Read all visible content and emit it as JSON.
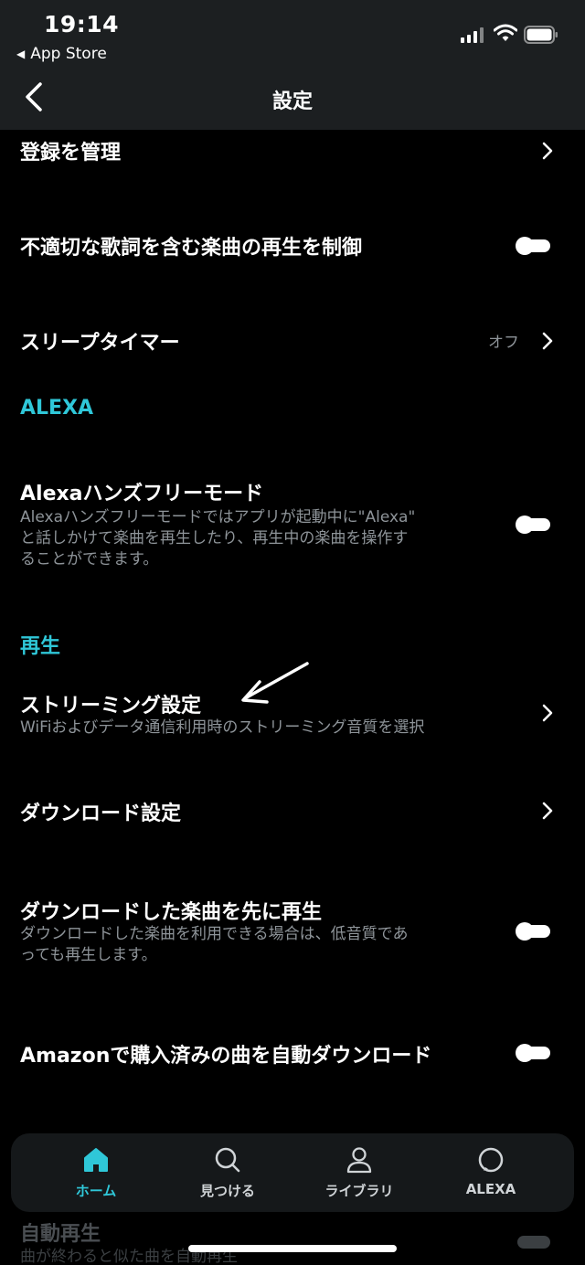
{
  "status_bar": {
    "time": "19:14",
    "back_app": "App Store"
  },
  "nav": {
    "title": "設定"
  },
  "rows": [
    {
      "title": "登録を管理"
    },
    {
      "title": "不適切な歌詞を含む楽曲の再生を制御"
    },
    {
      "title": "スリープタイマー",
      "value": "オフ"
    }
  ],
  "section_alexa": {
    "label": "ALEXA"
  },
  "alexa_row": {
    "title": "Alexaハンズフリーモード",
    "subtitle_lines": [
      "Alexaハンズフリーモードではアプリが起動中に\"Alexa\"",
      "と話しかけて楽曲を再生したり、再生中の楽曲を操作す",
      "ることができます。"
    ]
  },
  "section_playback": {
    "label": "再生"
  },
  "playback_rows": [
    {
      "title": "ストリーミング設定",
      "subtitle": "WiFiおよびデータ通信利用時のストリーミング音質を選択"
    },
    {
      "title": "ダウンロード設定"
    },
    {
      "title": "ダウンロードした楽曲を先に再生",
      "subtitle_lines": [
        "ダウンロードした楽曲を利用できる場合は、低音質であ",
        "っても再生します。"
      ]
    },
    {
      "title": "Amazonで購入済みの曲を自動ダウンロード"
    }
  ],
  "peek_row": {
    "title": "自動再生",
    "subtitle": "曲が終わると似た曲を自動再生"
  },
  "tabs": [
    {
      "label": "ホーム",
      "icon": "home-icon"
    },
    {
      "label": "見つける",
      "icon": "search-icon"
    },
    {
      "label": "ライブラリ",
      "icon": "person-icon"
    },
    {
      "label": "ALEXA",
      "icon": "alexa-ring-icon"
    }
  ],
  "colors": {
    "accent": "#2fc7d8",
    "background": "#000000",
    "subtext": "#8e9499"
  }
}
